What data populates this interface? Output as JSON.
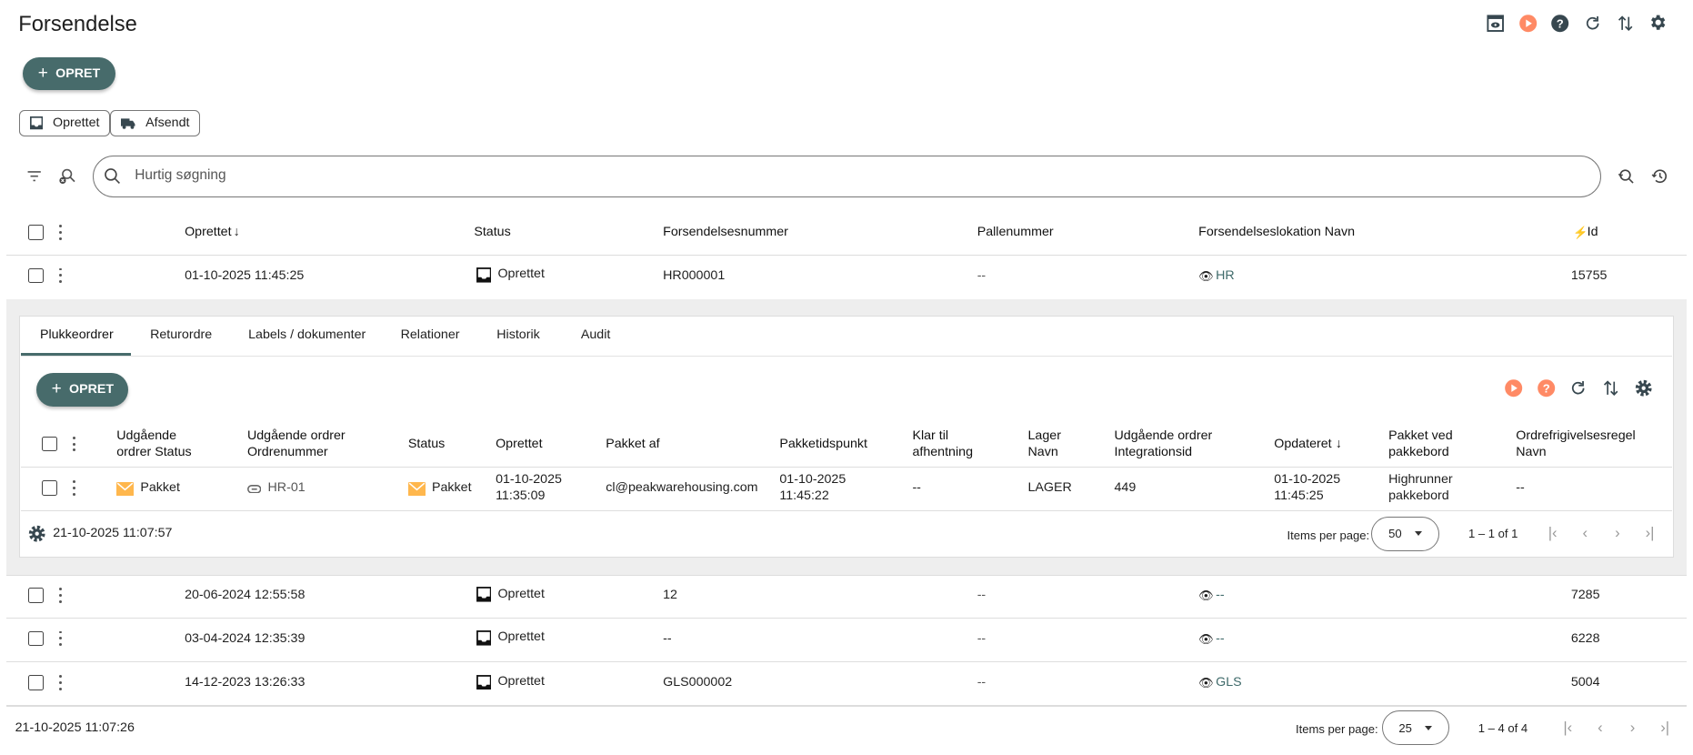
{
  "page": {
    "title": "Forsendelse"
  },
  "toolbar": {
    "opret_label": "OPRET",
    "chips": [
      {
        "label": "Oprettet",
        "icon": "inbox-icon"
      },
      {
        "label": "Afsendt",
        "icon": "truck-icon"
      }
    ]
  },
  "search": {
    "placeholder": "Hurtig søgning"
  },
  "colors": {
    "primary": "#476b6b",
    "accent": "#ff8a65",
    "dark": "#37474f",
    "status_packed": "#ffb74d"
  },
  "main_table": {
    "columns": [
      "Oprettet",
      "Status",
      "Forsendelsesnummer",
      "Pallenummer",
      "Forsendelseslokation Navn",
      "Id"
    ],
    "rows": [
      {
        "oprettet": "01-10-2025 11:45:25",
        "status": "Oprettet",
        "forsendelsesnummer": "HR000001",
        "pallenummer": "--",
        "lokation": "HR",
        "id": "15755"
      },
      {
        "oprettet": "20-06-2024 12:55:58",
        "status": "Oprettet",
        "forsendelsesnummer": "12",
        "pallenummer": "--",
        "lokation": "--",
        "id": "7285"
      },
      {
        "oprettet": "03-04-2024 12:35:39",
        "status": "Oprettet",
        "forsendelsesnummer": "--",
        "pallenummer": "--",
        "lokation": "--",
        "id": "6228"
      },
      {
        "oprettet": "14-12-2023 13:26:33",
        "status": "Oprettet",
        "forsendelsesnummer": "GLS000002",
        "pallenummer": "--",
        "lokation": "GLS",
        "id": "5004"
      }
    ],
    "footer": {
      "timestamp": "21-10-2025 11:07:26",
      "items_per_page_label": "Items per page:",
      "items_per_page": "25",
      "range": "1 – 4 of 4"
    }
  },
  "detail": {
    "tabs": [
      "Plukkeordrer",
      "Returordre",
      "Labels / dokumenter",
      "Relationer",
      "Historik",
      "Audit"
    ],
    "active_tab": "Plukkeordrer",
    "opret_label": "OPRET",
    "columns": [
      [
        "Udgående",
        "ordrer Status"
      ],
      [
        "Udgående ordrer",
        "Ordrenummer"
      ],
      [
        "Status"
      ],
      [
        "Oprettet"
      ],
      [
        "Pakket af"
      ],
      [
        "Pakketidspunkt"
      ],
      [
        "Klar til",
        "afhentning"
      ],
      [
        "Lager",
        "Navn"
      ],
      [
        "Udgående ordrer",
        "Integrationsid"
      ],
      [
        "Opdateret ↓"
      ],
      [
        "Pakket ved",
        "pakkebord"
      ],
      [
        "Ordrefrigivelsesregel",
        "Navn"
      ]
    ],
    "rows": [
      {
        "cells": [
          [
            "Pakket"
          ],
          [
            "HR-01"
          ],
          [
            "Pakket"
          ],
          [
            "01-10-2025",
            "11:35:09"
          ],
          [
            "cl@peakwarehousing.com"
          ],
          [
            "01-10-2025",
            "11:45:22"
          ],
          [
            "--"
          ],
          [
            "LAGER"
          ],
          [
            "449"
          ],
          [
            "01-10-2025",
            "11:45:25"
          ],
          [
            "Highrunner",
            "pakkebord"
          ],
          [
            "--"
          ]
        ]
      }
    ],
    "footer": {
      "timestamp": "21-10-2025 11:07:57",
      "items_per_page_label": "Items per page:",
      "items_per_page": "50",
      "range": "1 – 1 of 1"
    }
  }
}
